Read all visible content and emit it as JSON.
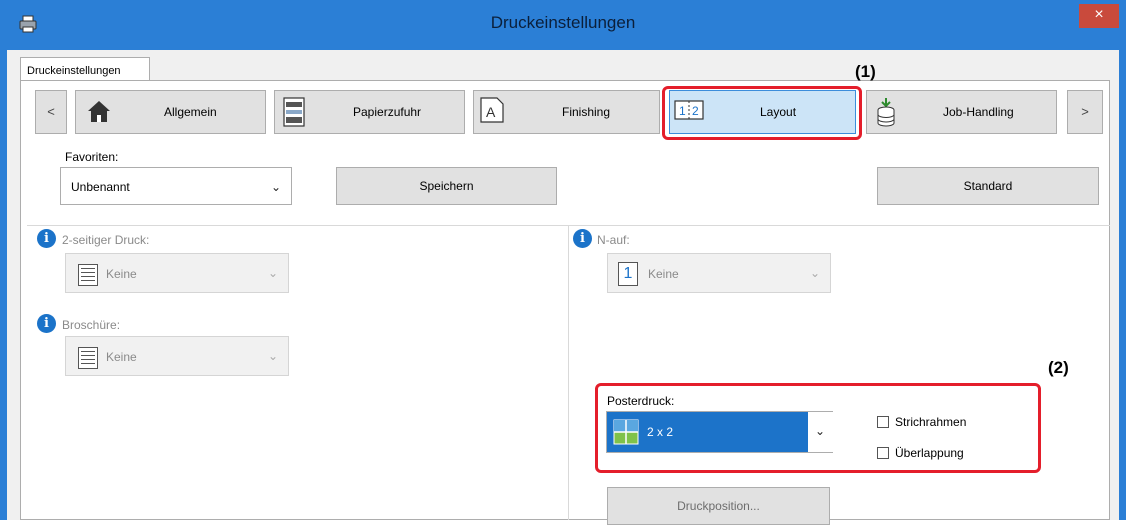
{
  "window": {
    "title": "Druckeinstellungen",
    "close_glyph": "×"
  },
  "tab": {
    "label": "Druckeinstellungen"
  },
  "nav": {
    "prev": "<",
    "next": ">",
    "items": [
      {
        "label": "Allgemein",
        "icon": "house-icon"
      },
      {
        "label": "Papierzufuhr",
        "icon": "printer-tray-icon"
      },
      {
        "label": "Finishing",
        "icon": "page-a-icon"
      },
      {
        "label": "Layout",
        "icon": "n-up-icon",
        "selected": true
      },
      {
        "label": "Job-Handling",
        "icon": "database-icon"
      }
    ]
  },
  "annotations": {
    "one": "(1)",
    "two": "(2)"
  },
  "favoriten": {
    "label": "Favoriten:",
    "value": "Unbenannt",
    "save": "Speichern",
    "standard": "Standard"
  },
  "duplex": {
    "label": "2-seitiger Druck:",
    "value": "Keine"
  },
  "brochure": {
    "label": "Broschüre:",
    "value": "Keine"
  },
  "nup": {
    "label": "N-auf:",
    "value": "Keine",
    "icon_glyph": "1"
  },
  "poster": {
    "label": "Posterdruck:",
    "value": "2 x 2",
    "frame": "Strichrahmen",
    "overlap": "Überlappung"
  },
  "position_button": "Druckposition...",
  "colors": {
    "title_bar": "#2b7fd6",
    "selection": "#1c73c9",
    "annotation": "#e41e2b"
  }
}
